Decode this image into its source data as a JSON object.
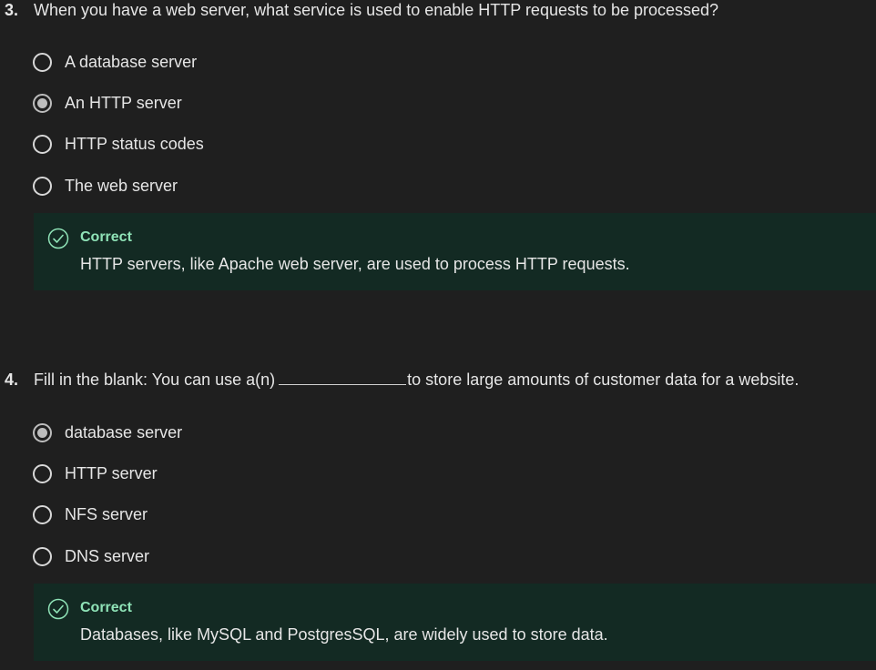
{
  "questions": [
    {
      "number": "3.",
      "text": "When you have a web server, what service is used to enable HTTP requests to be processed?",
      "options": [
        {
          "label": "A database server",
          "selected": false
        },
        {
          "label": "An HTTP server",
          "selected": true
        },
        {
          "label": "HTTP status codes",
          "selected": false
        },
        {
          "label": "The web server",
          "selected": false
        }
      ],
      "feedback": {
        "status": "Correct",
        "text": "HTTP servers, like Apache web server, are used to process HTTP requests.",
        "icon": "check-circle-icon"
      }
    },
    {
      "number": "4.",
      "text_before": "Fill in the blank: You can use a(n)",
      "text_after": "to store large amounts of customer data for a website.",
      "options": [
        {
          "label": "database server",
          "selected": true
        },
        {
          "label": "HTTP server",
          "selected": false
        },
        {
          "label": "NFS server",
          "selected": false
        },
        {
          "label": "DNS server",
          "selected": false
        }
      ],
      "feedback": {
        "status": "Correct",
        "text": "Databases, like MySQL and PostgresSQL, are widely used to store data.",
        "icon": "check-circle-icon"
      }
    }
  ],
  "colors": {
    "background": "#1f1f1f",
    "feedback_background": "#132a23",
    "correct_accent": "#8fe3b7"
  }
}
